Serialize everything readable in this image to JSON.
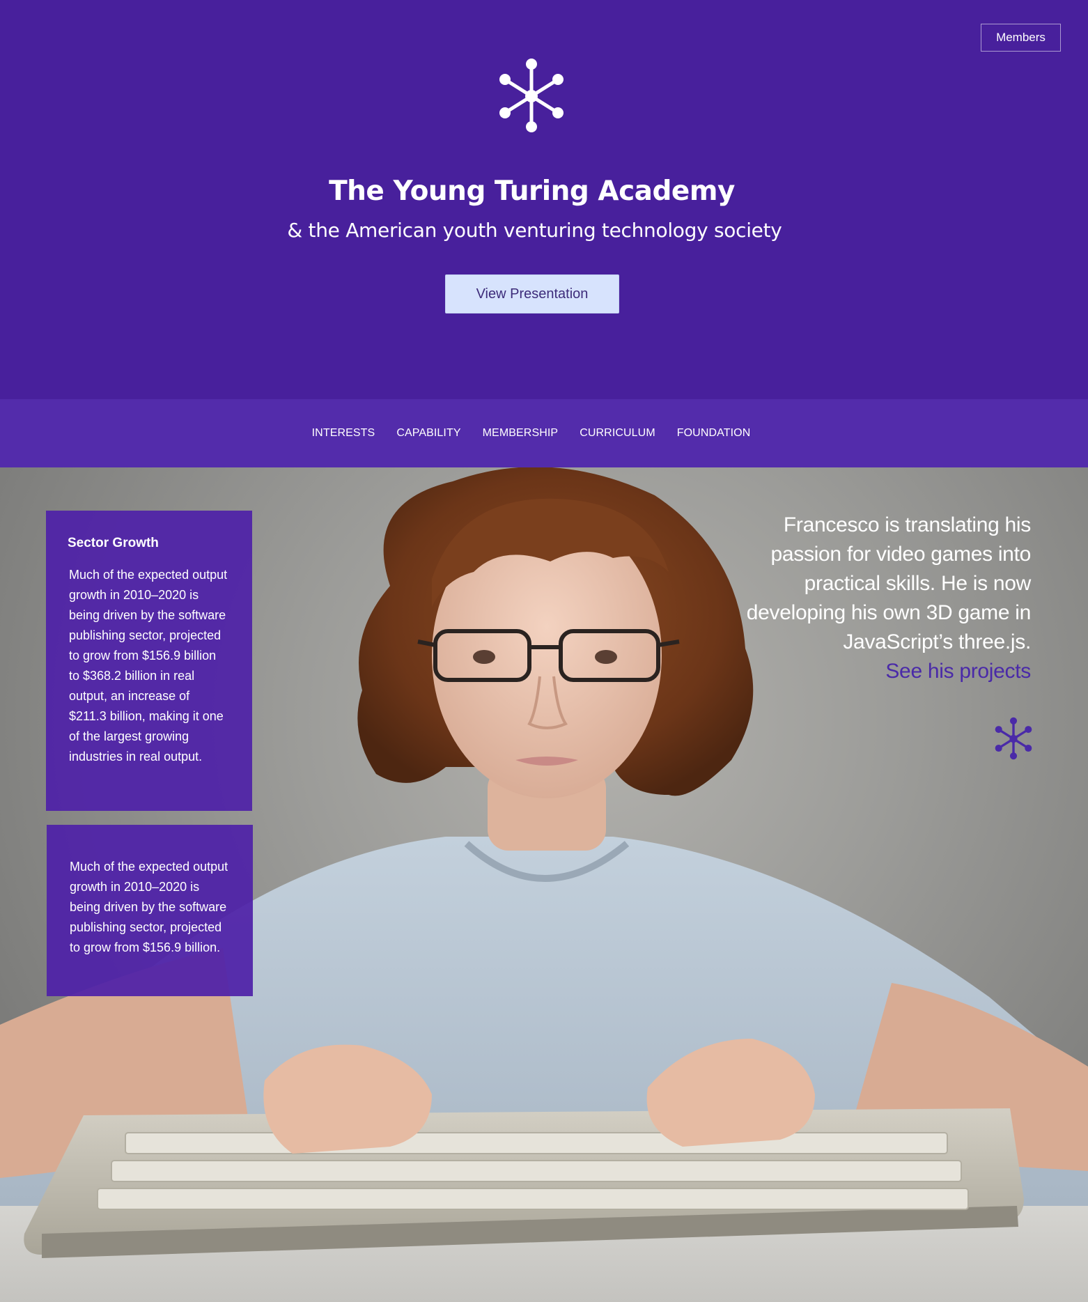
{
  "header": {
    "members_label": "Members",
    "title": "The Young Turing Academy",
    "subtitle": "& the American youth venturing technology society",
    "cta_label": "View Presentation"
  },
  "nav": {
    "items": [
      "INTERESTS",
      "CAPABILITY",
      "MEMBERSHIP",
      "CURRICULUM",
      "FOUNDATION"
    ]
  },
  "cards": [
    {
      "title": "Sector Growth",
      "body": "Much of the expected output growth in 2010–2020 is being driven by the software publishing sector, projected to grow from $156.9 billion to $368.2 billion in real output, an increase of $211.3 billion, making it one of the largest growing industries in real output."
    },
    {
      "body": "Much of the expected output growth in 2010–2020 is being driven by the software publishing sector, projected to grow from $156.9 billion."
    }
  ],
  "feature": {
    "quote": "Francesco is translating his passion for video games into practical skills. He is now developing his own 3D game in JavaScript’s three.js.",
    "link_label": "See his projects"
  },
  "icons": {
    "brand_logo": "molecule-icon",
    "feature_logo": "molecule-icon"
  },
  "colors": {
    "brand_purple": "#48209c",
    "nav_purple": "#532cab",
    "card_purple": "#4f21a8",
    "button_bg": "#d7e3fd",
    "link_color": "#4a2aa8"
  }
}
